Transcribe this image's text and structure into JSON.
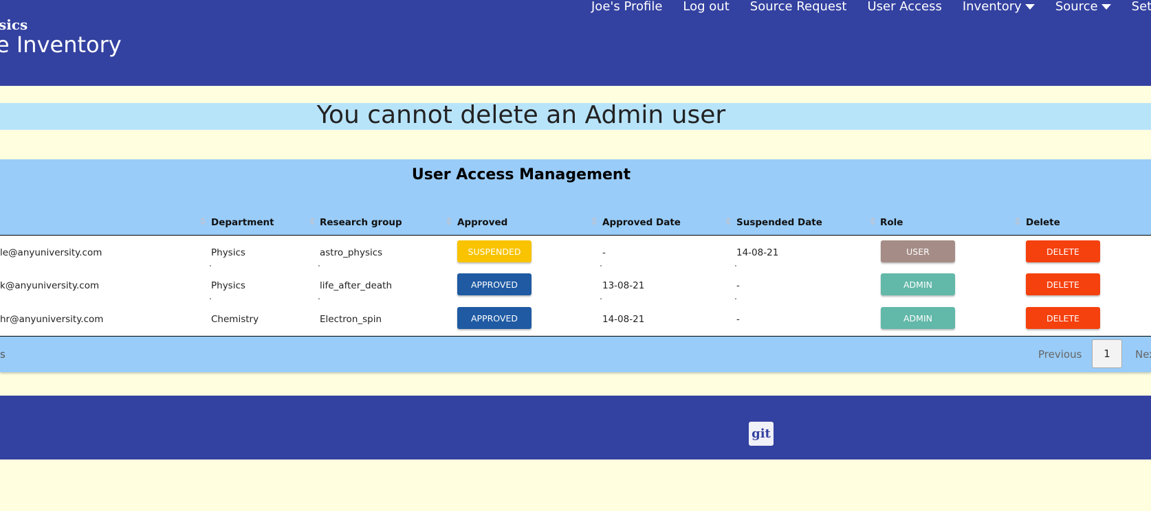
{
  "header": {
    "brand_top": "sics",
    "brand_main": "e Inventory",
    "nav": [
      {
        "label": "Joe's Profile"
      },
      {
        "label": "Log out"
      },
      {
        "label": "Source Request"
      },
      {
        "label": "User Access"
      },
      {
        "label": "Inventory",
        "dropdown": true
      },
      {
        "label": "Source",
        "dropdown": true
      },
      {
        "label": "Setting"
      }
    ]
  },
  "alert": {
    "message": "You cannot delete an Admin user"
  },
  "panel": {
    "title": "User Access Management",
    "columns": [
      "Department",
      "Research group",
      "Approved",
      "Approved Date",
      "Suspended Date",
      "Role",
      "Delete"
    ],
    "rows": [
      {
        "email": "le@anyuniversity.com",
        "department": "Physics",
        "group": "astro_physics",
        "approved": "SUSPENDED",
        "approved_date": "-",
        "suspended_date": "14-08-21",
        "role": "USER",
        "delete": "DELETE"
      },
      {
        "email": "k@anyuniversity.com",
        "department": "Physics",
        "group": "life_after_death",
        "approved": "APPROVED",
        "approved_date": "13-08-21",
        "suspended_date": "-",
        "role": "ADMIN",
        "delete": "DELETE"
      },
      {
        "email": "hr@anyuniversity.com",
        "department": "Chemistry",
        "group": "Electron_spin",
        "approved": "APPROVED",
        "approved_date": "14-08-21",
        "suspended_date": "-",
        "role": "ADMIN",
        "delete": "DELETE"
      }
    ],
    "footer_left": "s",
    "pagination": {
      "previous": "Previous",
      "page": "1",
      "next": "Nex"
    }
  },
  "footer": {
    "git_label": "git"
  },
  "colors": {
    "header_bg": "#3341a0",
    "page_bg": "#ffffe0",
    "alert_bg": "#b8e4fa",
    "panel_bg": "#99ccf8",
    "suspended": "#f9c300",
    "approved": "#1f5aa3",
    "user_role": "#a58c86",
    "admin_role": "#62b8a9",
    "delete": "#f5410e"
  }
}
